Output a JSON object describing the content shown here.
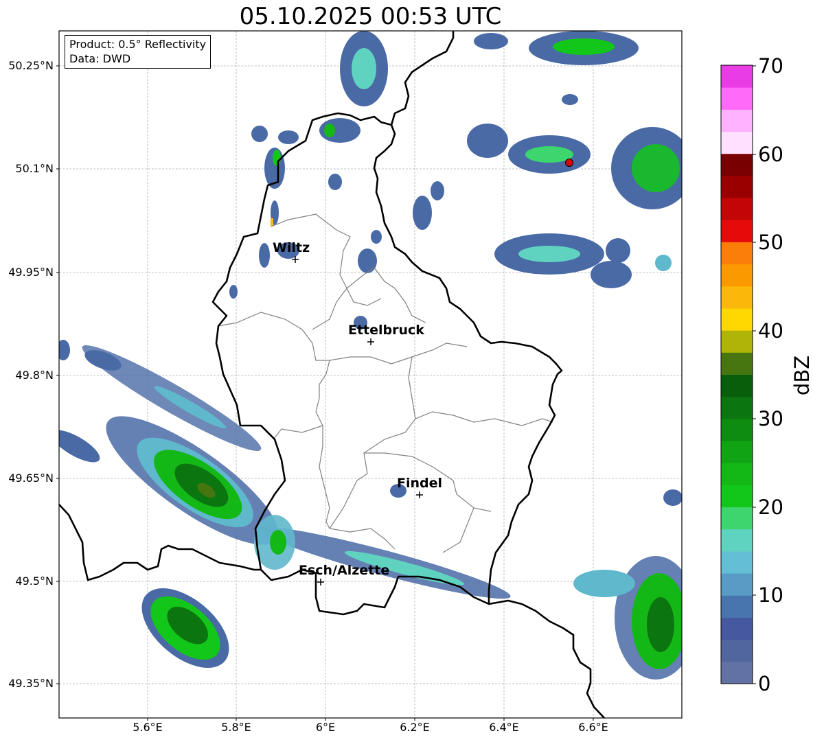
{
  "title": "05.10.2025 00:53 UTC",
  "info": {
    "product": "Product: 0.5° Reflectivity",
    "data": "Data: DWD"
  },
  "lat_labels": [
    "50.25°N",
    "50.1°N",
    "49.95°N",
    "49.8°N",
    "49.65°N",
    "49.5°N",
    "49.35°N"
  ],
  "lon_labels": [
    "5.6°E",
    "5.8°E",
    "6°E",
    "6.2°E",
    "6.4°E",
    "6.6°E"
  ],
  "cities": [
    {
      "name": "Wiltz",
      "lon": 5.93,
      "lat": 49.97
    },
    {
      "name": "Ettelbruck",
      "lon": 6.1,
      "lat": 49.85
    },
    {
      "name": "Findel",
      "lon": 6.21,
      "lat": 49.63
    },
    {
      "name": "Esch/Alzette",
      "lon": 5.99,
      "lat": 49.5
    }
  ],
  "colorbar": {
    "label": "dBZ",
    "ticks": [
      "70",
      "60",
      "50",
      "40",
      "30",
      "20",
      "10",
      "0"
    ],
    "colors": [
      "#6272a4",
      "#52669e",
      "#4659a0",
      "#4875ad",
      "#599bc4",
      "#64bfd6",
      "#5fd3c0",
      "#3dd66e",
      "#12c61a",
      "#14b816",
      "#10a414",
      "#0e8c10",
      "#0b7510",
      "#085e0a",
      "#477510",
      "#b0b409",
      "#fed800",
      "#fcb70b",
      "#fb9a00",
      "#fc7e0a",
      "#e70a0a",
      "#c20606",
      "#9b0000",
      "#790000",
      "#ffe0ff",
      "#ffb2ff",
      "#ff6af9",
      "#e93ce6"
    ]
  },
  "colors": {
    "border": "#000000",
    "admin": "#808080",
    "grid": "#b0b0b0"
  }
}
